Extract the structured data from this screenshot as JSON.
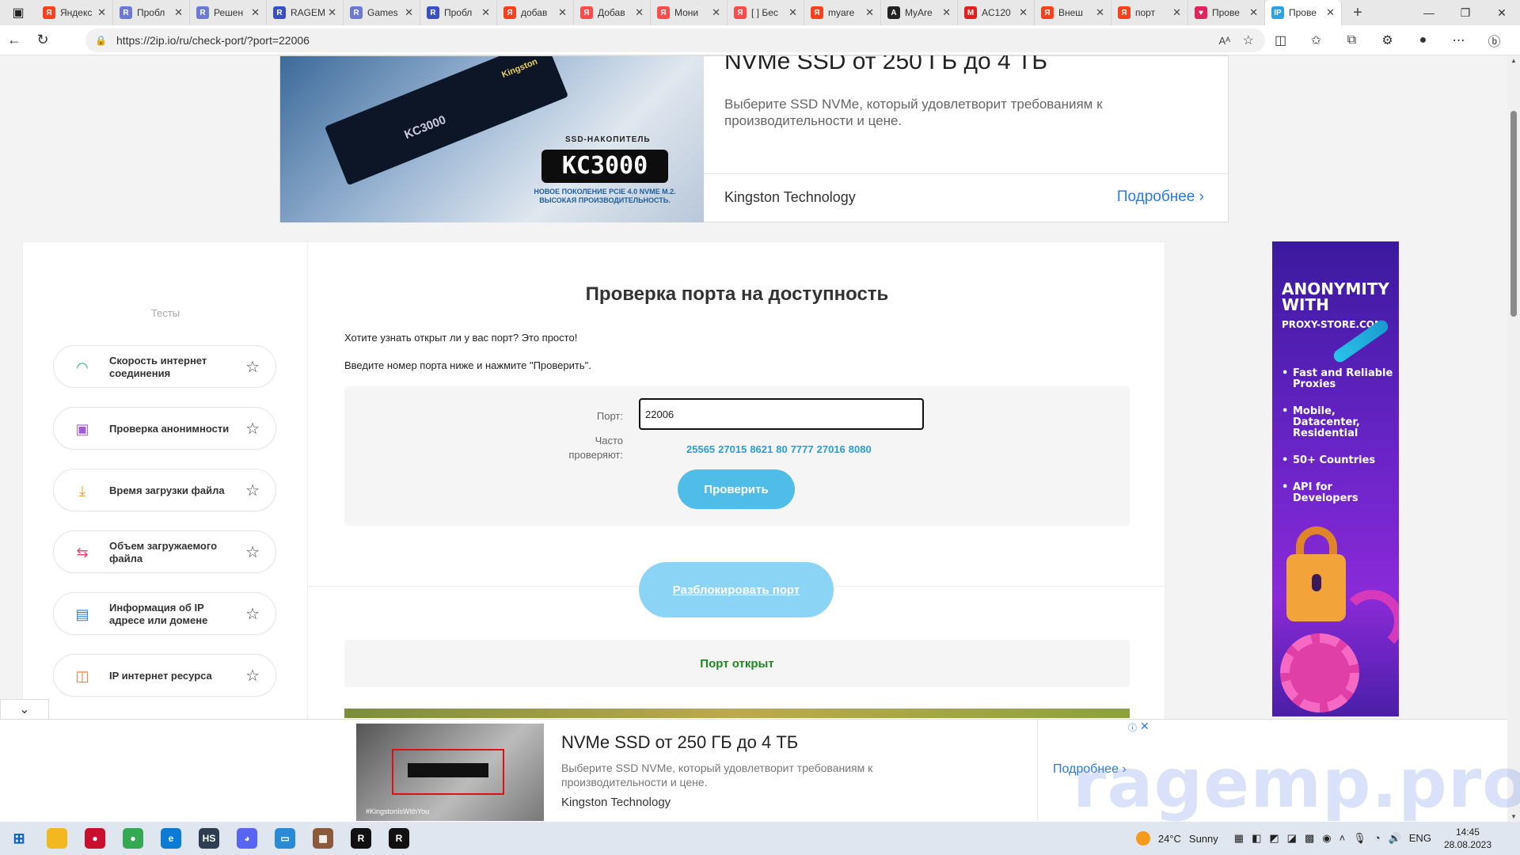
{
  "browser": {
    "tabs": [
      {
        "title": "Яндекс",
        "fav_color": "#fc3f1d",
        "fav_glyph": "Я"
      },
      {
        "title": "Пробл",
        "fav_color": "#6c7ad6",
        "fav_glyph": "R"
      },
      {
        "title": "Решен",
        "fav_color": "#6c7ad6",
        "fav_glyph": "R"
      },
      {
        "title": "RAGEM",
        "fav_color": "#3a4fc4",
        "fav_glyph": "R"
      },
      {
        "title": "Games",
        "fav_color": "#6c7ad6",
        "fav_glyph": "R"
      },
      {
        "title": "Пробл",
        "fav_color": "#3a4fc4",
        "fav_glyph": "R"
      },
      {
        "title": "добав",
        "fav_color": "#fc3f1d",
        "fav_glyph": "Я"
      },
      {
        "title": "Добав",
        "fav_color": "#ff4b4b",
        "fav_glyph": "Я"
      },
      {
        "title": "Мони",
        "fav_color": "#ff4b4b",
        "fav_glyph": "Я"
      },
      {
        "title": "[ ] Бес",
        "fav_color": "#ff4b4b",
        "fav_glyph": "Я"
      },
      {
        "title": "myare",
        "fav_color": "#fc3f1d",
        "fav_glyph": "Я"
      },
      {
        "title": "MyAre",
        "fav_color": "#222222",
        "fav_glyph": "A"
      },
      {
        "title": "AC120",
        "fav_color": "#e02020",
        "fav_glyph": "M"
      },
      {
        "title": "Внеш",
        "fav_color": "#fc3f1d",
        "fav_glyph": "Я"
      },
      {
        "title": "порт",
        "fav_color": "#fc3f1d",
        "fav_glyph": "Я"
      },
      {
        "title": "Прове",
        "fav_color": "#e0245e",
        "fav_glyph": "♥"
      },
      {
        "title": "Прове",
        "fav_color": "#2ea1e0",
        "fav_glyph": "IP"
      }
    ],
    "url": "https://2ip.io/ru/check-port/?port=22006",
    "read_aloud": "Aᴬ"
  },
  "top_ad": {
    "product_brand": "Kingston",
    "product_model": "KC3000",
    "product_label": "SSD-НАКОПИТЕЛЬ",
    "product_name": "KC3000",
    "product_sub": "НОВОЕ ПОКОЛЕНИЕ PCIE 4.0 NVME M.2. ВЫСОКАЯ ПРОИЗВОДИТЕЛЬНОСТЬ.",
    "title": "NVMe SSD от 250 ГБ до 4 ТБ",
    "description": "Выберите SSD NVMe, который удовлетворит требованиям к производительности и цене.",
    "advertiser": "Kingston Technology",
    "more": "Подробнее"
  },
  "sidebar": {
    "title": "Тесты",
    "items": [
      {
        "label": "Скорость интернет соединения",
        "icon": "speedometer-icon",
        "glyph": "◠",
        "color": "#2eb872"
      },
      {
        "label": "Проверка анонимности",
        "icon": "anonymity-icon",
        "glyph": "▣",
        "color": "#a25bd6"
      },
      {
        "label": "Время загрузки файла",
        "icon": "download-icon",
        "glyph": "⤓",
        "color": "#e4a62a"
      },
      {
        "label": "Объем загружаемого файла",
        "icon": "file-size-icon",
        "glyph": "⇆",
        "color": "#e5446d"
      },
      {
        "label": "Информация об IP адресе или домене",
        "icon": "ip-info-icon",
        "glyph": "▤",
        "color": "#2d7fd6"
      },
      {
        "label": "IP интернет ресурса",
        "icon": "ip-resource-icon",
        "glyph": "◫",
        "color": "#e07a3a"
      }
    ]
  },
  "main": {
    "heading": "Проверка порта на доступность",
    "intro1": "Хотите узнать открыт ли у вас порт? Это просто!",
    "intro2": "Введите номер порта ниже и нажмите \"Проверить\".",
    "port_label": "Порт:",
    "port_value": "22006",
    "often_label": "Часто проверяют:",
    "often_ports": [
      "25565",
      "27015",
      "8621",
      "80",
      "7777",
      "27016",
      "8080"
    ],
    "check_button": "Проверить",
    "unblock_button": "Разблокировать порт",
    "result": "Порт открыт"
  },
  "right_ad": {
    "title": "ANONYMITY WITH",
    "site": "PROXY-STORE.COM",
    "features": [
      "Fast and Reliable Proxies",
      "Mobile, Datacenter, Residential",
      "50+ Countries",
      "API for Developers"
    ]
  },
  "bottom_ad": {
    "image_tag": "#KingstonIsWithYou",
    "title": "NVMe SSD от 250 ГБ до 4 ТБ",
    "description": "Выберите SSD NVMe, который удовлетворит требованиям к производительности и цене.",
    "advertiser": "Kingston Technology",
    "more": "Подробнее"
  },
  "watermark": "ragemp.pro",
  "taskbar": {
    "apps": [
      {
        "name": "file-explorer-icon",
        "color": "#f3b820",
        "glyph": ""
      },
      {
        "name": "app-red-icon",
        "color": "#c8102e",
        "glyph": "●"
      },
      {
        "name": "chrome-icon",
        "color": "#34a853",
        "glyph": "●"
      },
      {
        "name": "edge-icon",
        "color": "#0c7bd6",
        "glyph": "e"
      },
      {
        "name": "hs-icon",
        "color": "#2c3e50",
        "glyph": "HS"
      },
      {
        "name": "discord-icon",
        "color": "#5865f2",
        "glyph": "◕"
      },
      {
        "name": "remote-desktop-icon",
        "color": "#2a8ad6",
        "glyph": "▭"
      },
      {
        "name": "box-app-icon",
        "color": "#8a5a3a",
        "glyph": "▦"
      },
      {
        "name": "rockstar-icon",
        "color": "#111111",
        "glyph": "R"
      },
      {
        "name": "rockstar-launcher-icon",
        "color": "#111111",
        "glyph": "R"
      }
    ],
    "weather_temp": "24°C",
    "weather_desc": "Sunny",
    "lang": "ENG",
    "time": "14:45",
    "date": "28.08.2023"
  }
}
